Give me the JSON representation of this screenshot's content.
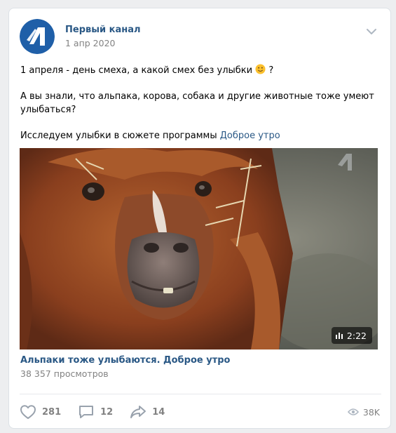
{
  "post": {
    "author": "Первый канал",
    "date": "1 апр 2020",
    "text": {
      "line1": "1 апреля - день смеха, а какой смех без улыбки",
      "line1_suffix": "?",
      "line2": "А вы знали, что альпака, корова, собака и другие животные тоже умеют улыбаться?",
      "line3_prefix": "Исследуем улыбки в сюжете программы",
      "line3_link": "Доброе утро"
    }
  },
  "video": {
    "title": "Альпаки тоже улыбаются. Доброе утро",
    "views": "38 357 просмотров",
    "duration": "2:22"
  },
  "actions": {
    "likes": "281",
    "comments": "12",
    "shares": "14",
    "views": "38K"
  },
  "colors": {
    "link": "#2a5885",
    "secondary": "#828282",
    "channel_logo_blue": "#1f5fa8"
  },
  "icons": [
    "channel-logo-icon",
    "chevron-down-icon",
    "smiley-emoji-icon",
    "equalizer-icon",
    "heart-icon",
    "comment-icon",
    "share-icon",
    "eye-icon"
  ]
}
